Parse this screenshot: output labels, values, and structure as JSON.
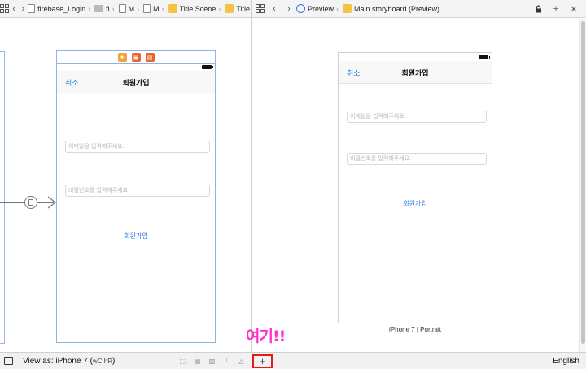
{
  "left_bar": {
    "crumbs": [
      "firebase_Login",
      "fi",
      "M",
      "M",
      "Title Scene",
      "Title"
    ]
  },
  "right_bar": {
    "preview_label": "Preview",
    "file_label": "Main.storyboard (Preview)"
  },
  "scene": {
    "nav_cancel": "취소",
    "nav_title": "회원가입",
    "email_placeholder": "이메일을 입력해주세요.",
    "password_placeholder": "비밀번호를 입력해주세요.",
    "signup_button": "회원가입"
  },
  "preview": {
    "nav_cancel": "취소",
    "nav_title": "회원가입",
    "email_placeholder": "이메일을 입력해주세요.",
    "password_placeholder": "비밀번호를 입력해주세요.",
    "signup_button": "회원가입",
    "device_caption": "iPhone 7 | Portrait"
  },
  "bottom_bar": {
    "view_as": "View as: iPhone 7 (",
    "size_class": "wC hR",
    "view_as_close": ")",
    "language": "English",
    "add_symbol": "+"
  },
  "annotation": "여기!!",
  "colors": {
    "accent": "#2a7ae2",
    "annotation": "#ff33cc",
    "highlight": "#e51b1b"
  }
}
